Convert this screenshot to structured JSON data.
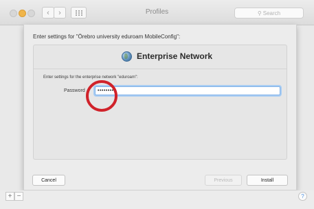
{
  "window": {
    "title": "Profiles",
    "search_placeholder": "Search",
    "nav_back": "‹",
    "nav_forward": "›"
  },
  "sheet": {
    "prompt": "Enter settings for \"Örebro university eduroam MobileConfig\":",
    "panel_title": "Enterprise Network",
    "network_prompt": "Enter settings for the enterprise network \"eduroam\":",
    "password_label": "Password",
    "password_value": "•••••••••",
    "cancel_label": "Cancel",
    "previous_label": "Previous",
    "install_label": "Install"
  },
  "bottom": {
    "add_label": "+",
    "remove_label": "−",
    "help_label": "?"
  },
  "colors": {
    "highlight_ring": "#d0222a",
    "focus_ring": "#a9cdf3",
    "minimize_button": "#f0b54a"
  },
  "icons": {
    "panel_icon": "globe-icon",
    "search_icon": "search-icon"
  }
}
